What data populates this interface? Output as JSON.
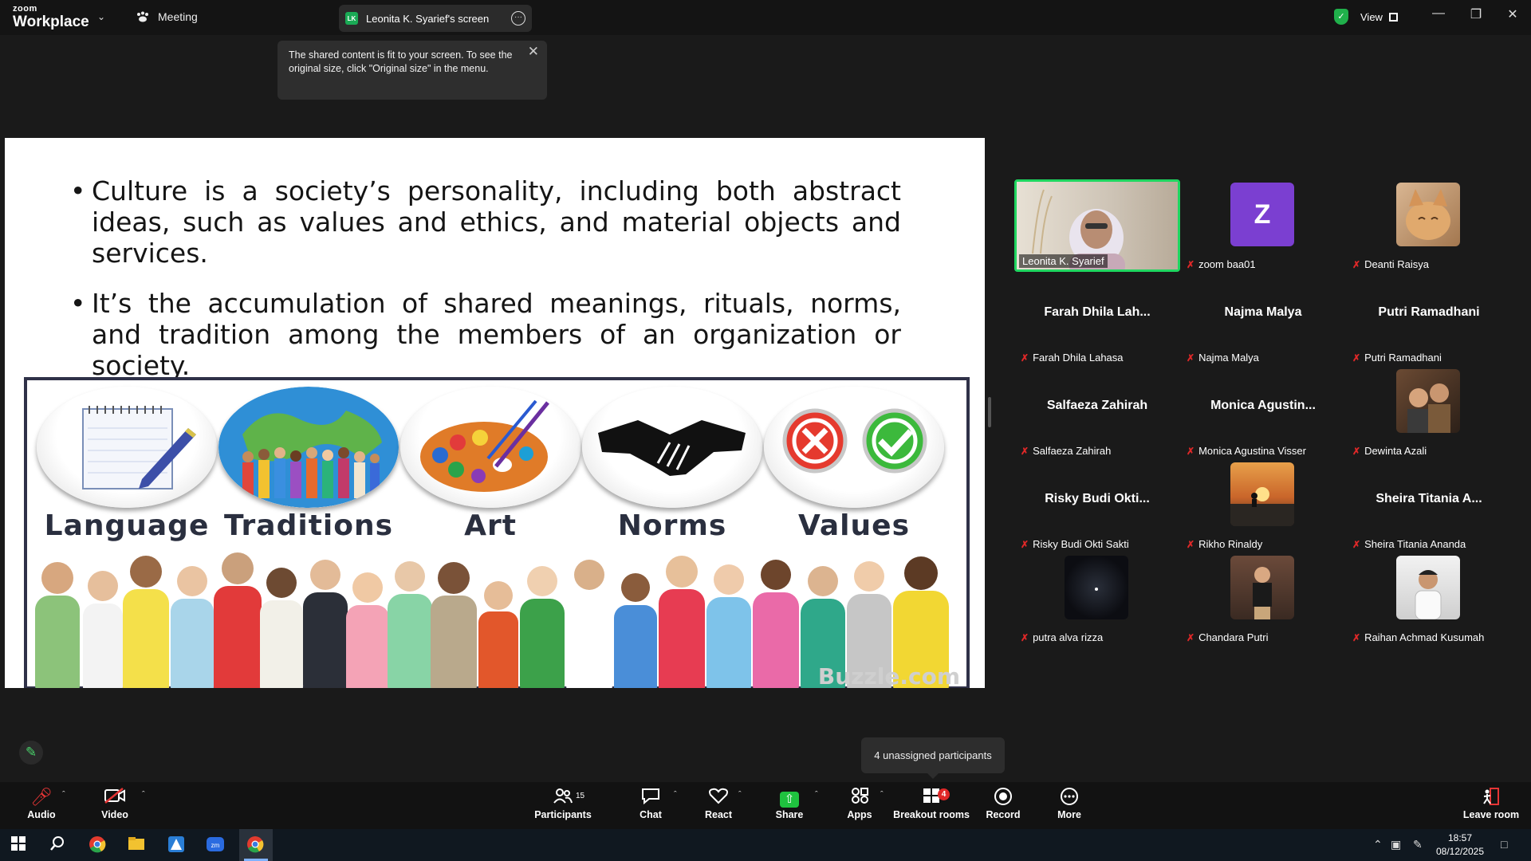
{
  "titlebar": {
    "logo_small": "zoom",
    "logo_big": "Workplace",
    "meeting_label": "Meeting",
    "screen_badge": "LK",
    "screen_tab": "Leonita K. Syarief's screen",
    "view_label": "View",
    "shield_color": "#20b04b"
  },
  "tooltip": {
    "text": "The shared content is fit to your screen. To see the original size, click \"Original size\" in the menu."
  },
  "slide": {
    "bullet1": "Culture is a society’s personality, including both abstract ideas, such as values and ethics, and material objects and services.",
    "bullet2": "It’s the accumulation of shared meanings, rituals, norms, and tradition among the members of an organization or society.",
    "image_labels": [
      "Language",
      "Traditions",
      "Art",
      "Norms",
      "Values"
    ],
    "watermark": "Buzzle.com"
  },
  "gallery": {
    "tiles": [
      {
        "name": "Leonita K. Syarief",
        "type": "video",
        "muted": false
      },
      {
        "name": "zoom baa01",
        "type": "letter",
        "letter": "Z",
        "muted": true
      },
      {
        "name": "Deanti Raisya",
        "type": "photo",
        "muted": true
      },
      {
        "name": "Farah Dhila Lahasa",
        "display": "Farah Dhila Lah...",
        "type": "name",
        "muted": true
      },
      {
        "name": "Najma Malya",
        "display": "Najma Malya",
        "type": "name",
        "muted": true
      },
      {
        "name": "Putri Ramadhani",
        "display": "Putri Ramadhani",
        "type": "name",
        "muted": true
      },
      {
        "name": "Salfaeza Zahirah",
        "display": "Salfaeza Zahirah",
        "type": "name",
        "muted": true
      },
      {
        "name": "Monica Agustina Visser",
        "display": "Monica Agustin...",
        "type": "name",
        "muted": true
      },
      {
        "name": "Dewinta Azali",
        "type": "photo",
        "muted": true
      },
      {
        "name": "Risky Budi Okti Sakti",
        "display": "Risky Budi Okti...",
        "type": "name",
        "muted": true
      },
      {
        "name": "Rikho Rinaldy",
        "type": "photo",
        "muted": true
      },
      {
        "name": "Sheira Titania Ananda",
        "display": "Sheira Titania A...",
        "type": "name",
        "muted": true
      },
      {
        "name": "putra alva rizza",
        "type": "photo",
        "muted": true
      },
      {
        "name": "Chandara Putri",
        "type": "photo",
        "muted": true
      },
      {
        "name": "Raihan Achmad Kusumah",
        "type": "photo",
        "muted": true
      }
    ],
    "unassigned": "4 unassigned participants"
  },
  "toolbar": {
    "audio": "Audio",
    "video": "Video",
    "participants": "Participants",
    "participants_count": "15",
    "chat": "Chat",
    "react": "React",
    "share": "Share",
    "apps": "Apps",
    "breakout": "Breakout rooms",
    "breakout_badge": "4",
    "record": "Record",
    "more": "More",
    "leave": "Leave room"
  },
  "taskbar": {
    "time": "18:57",
    "date": "08/12/2025"
  }
}
